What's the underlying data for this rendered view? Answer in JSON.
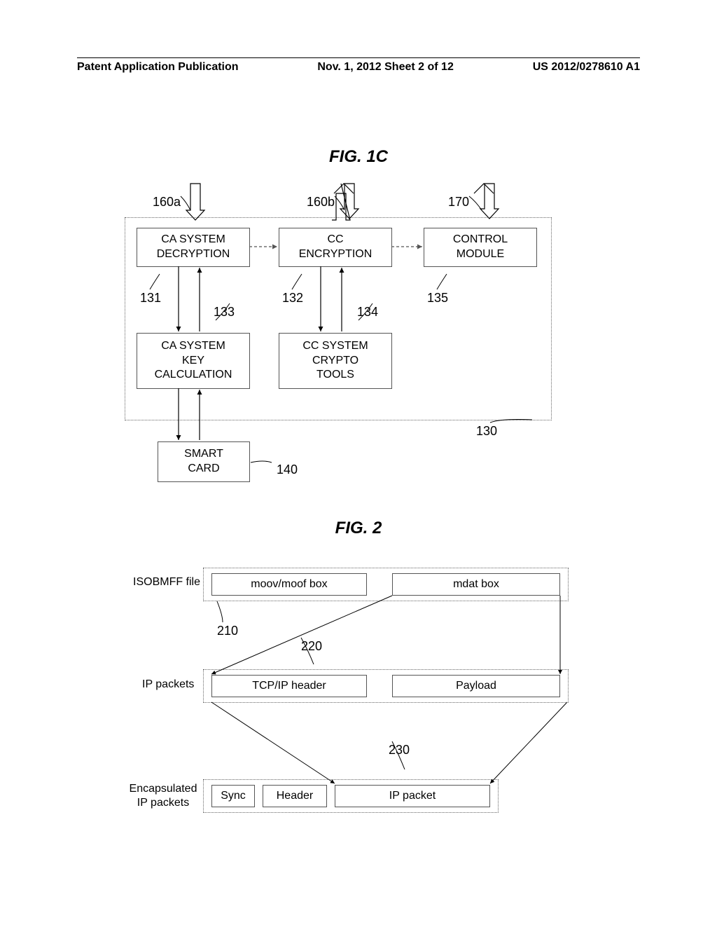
{
  "header": {
    "left": "Patent Application Publication",
    "center": "Nov. 1, 2012  Sheet 2 of 12",
    "right": "US 2012/0278610 A1"
  },
  "fig1c": {
    "title": "FIG. 1C",
    "ref160a": "160a",
    "ref160b": "160b",
    "ref170": "170",
    "ref131": "131",
    "ref132": "132",
    "ref133": "133",
    "ref134": "134",
    "ref135": "135",
    "ref130": "130",
    "ref140": "140",
    "box_ca_decrypt_l1": "CA SYSTEM",
    "box_ca_decrypt_l2": "DECRYPTION",
    "box_cc_enc_l1": "CC",
    "box_cc_enc_l2": "ENCRYPTION",
    "box_control_l1": "CONTROL",
    "box_control_l2": "MODULE",
    "box_ca_key_l1": "CA SYSTEM",
    "box_ca_key_l2": "KEY",
    "box_ca_key_l3": "CALCULATION",
    "box_cc_tools_l1": "CC SYSTEM",
    "box_cc_tools_l2": "CRYPTO",
    "box_cc_tools_l3": "TOOLS",
    "box_smart_l1": "SMART",
    "box_smart_l2": "CARD"
  },
  "fig2": {
    "title": "FIG. 2",
    "label_isobmff": "ISOBMFF file",
    "label_ip": "IP packets",
    "label_encap_l1": "Encapsulated",
    "label_encap_l2": "IP packets",
    "box_moov": "moov/moof box",
    "box_mdat": "mdat box",
    "box_tcpip": "TCP/IP header",
    "box_payload": "Payload",
    "box_sync": "Sync",
    "box_header": "Header",
    "box_ippacket": "IP packet",
    "ref210": "210",
    "ref220": "220",
    "ref230": "230"
  }
}
